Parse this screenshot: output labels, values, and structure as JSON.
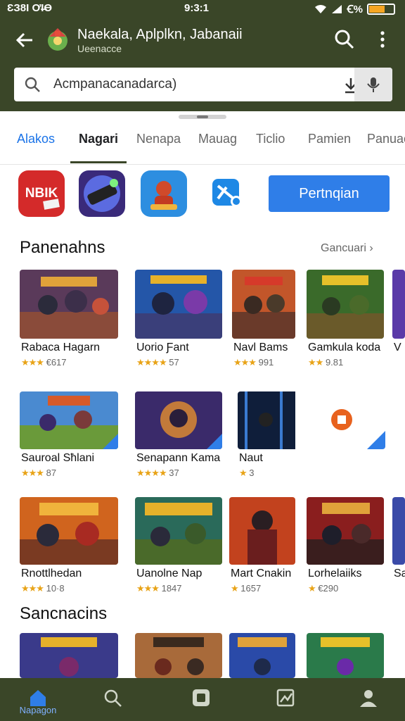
{
  "status_bar": {
    "left": "ƐЗ8I ƠΙ̶Ɵ",
    "time": "9:3:1",
    "right": "Ꞓ%"
  },
  "app_bar": {
    "title": "Naekala, Aplplkn, Jabanaii",
    "subtitle": "Ueenacce",
    "icons": [
      "back-arrow-icon",
      "app-logo-icon",
      "search-icon",
      "more-vert-icon"
    ]
  },
  "search": {
    "value": "Acmpanacanadarca)",
    "icons": [
      "magnifier-icon",
      "download-icon",
      "mic-icon"
    ]
  },
  "tabs": [
    "Alakos",
    "Nagari",
    "Nenapa",
    "Mauag",
    "Ticlio",
    "Pamien",
    "Panuao"
  ],
  "featured": {
    "icons": [
      "nbik-app-icon",
      "game-app-icon",
      "character-app-icon",
      "game-pad-app-icon"
    ],
    "nbik_text": "NBIK",
    "button_label": "Pertnqian"
  },
  "sections": {
    "first_title": "Panenahns",
    "first_more": "Gancuari",
    "second_title": "Sancnacins"
  },
  "rows": [
    [
      {
        "name": "Rabaca Hagarn",
        "rating": "€617",
        "stars": "★★★"
      },
      {
        "name": "Uorio Ƒant",
        "rating": "57",
        "stars": "★★★★"
      },
      {
        "name": "Navl Bams",
        "rating": "991",
        "stars": "★★★"
      },
      {
        "name": "Gamkula koda",
        "rating": "9.81",
        "stars": "★★"
      },
      {
        "name": "V",
        "rating": "",
        "stars": ""
      }
    ],
    [
      {
        "name": "Sauroal Sħlani",
        "rating": "87",
        "stars": "★★★"
      },
      {
        "name": "Senapann Kama",
        "rating": "37",
        "stars": "★★★★"
      },
      {
        "name": "Naut",
        "rating": "3",
        "stars": "★"
      }
    ],
    [
      {
        "name": "Rnottlhedan",
        "rating": "10·8",
        "stars": "★★★"
      },
      {
        "name": "Uanolne Nap",
        "rating": "1847",
        "stars": "★★★"
      },
      {
        "name": "Mart Cnakin",
        "rating": "1657",
        "stars": "★"
      },
      {
        "name": "Lorhelaiiks",
        "rating": "€290",
        "stars": "★"
      },
      {
        "name": "Sa",
        "rating": "",
        "stars": ""
      }
    ]
  ],
  "bottom_nav": [
    {
      "label": "Napagon",
      "icon": "home-icon"
    },
    {
      "label": "",
      "icon": "search-icon"
    },
    {
      "label": "",
      "icon": "apps-icon"
    },
    {
      "label": "",
      "icon": "library-icon"
    },
    {
      "label": "",
      "icon": "profile-icon"
    }
  ],
  "colors": {
    "app_bar": "#3a4628",
    "accent": "#2f7ee8",
    "star": "#e8a317",
    "tab_first": "#1a73e8"
  }
}
